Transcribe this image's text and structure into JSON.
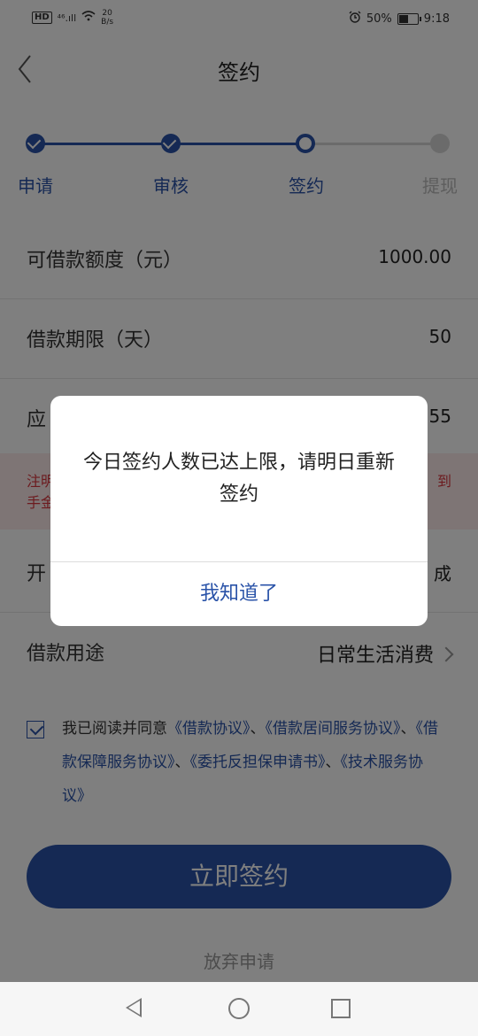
{
  "status_bar": {
    "hd": "HD",
    "signal": "⁴⁶.ıll",
    "speed_value": "20",
    "speed_unit": "B/s",
    "battery": "50%",
    "time": "9:18",
    "battery_level": 0.5
  },
  "navbar": {
    "title": "签约"
  },
  "steps": [
    {
      "label": "申请",
      "state": "done"
    },
    {
      "label": "审核",
      "state": "done"
    },
    {
      "label": "签约",
      "state": "current"
    },
    {
      "label": "提现",
      "state": "todo"
    }
  ],
  "rows": [
    {
      "label": "可借款额度（元）",
      "value": "1000.00"
    },
    {
      "label": "借款期限（天）",
      "value": "50"
    },
    {
      "label": "应",
      "value": ".55"
    },
    {
      "label": "开",
      "value": "成"
    },
    {
      "label": "借款用途",
      "value": "日常生活消费"
    }
  ],
  "notice": {
    "line1_left": "注明",
    "line1_right": "到",
    "line2_left": "手金"
  },
  "agreement": {
    "prefix": "我已阅读并同意",
    "links": [
      "《借款协议》",
      "《借款居间服务协议》",
      "《借款保障服务协议》",
      "《委托反担保申请书》",
      "《技术服务协议》"
    ],
    "sep": "、"
  },
  "buttons": {
    "sign": "立即签约",
    "abandon": "放弃申请"
  },
  "dialog": {
    "message": "今日签约人数已达上限，请明日重新签约",
    "confirm": "我知道了"
  },
  "colors": {
    "primary": "#2a53a8",
    "danger": "#d9363e"
  }
}
